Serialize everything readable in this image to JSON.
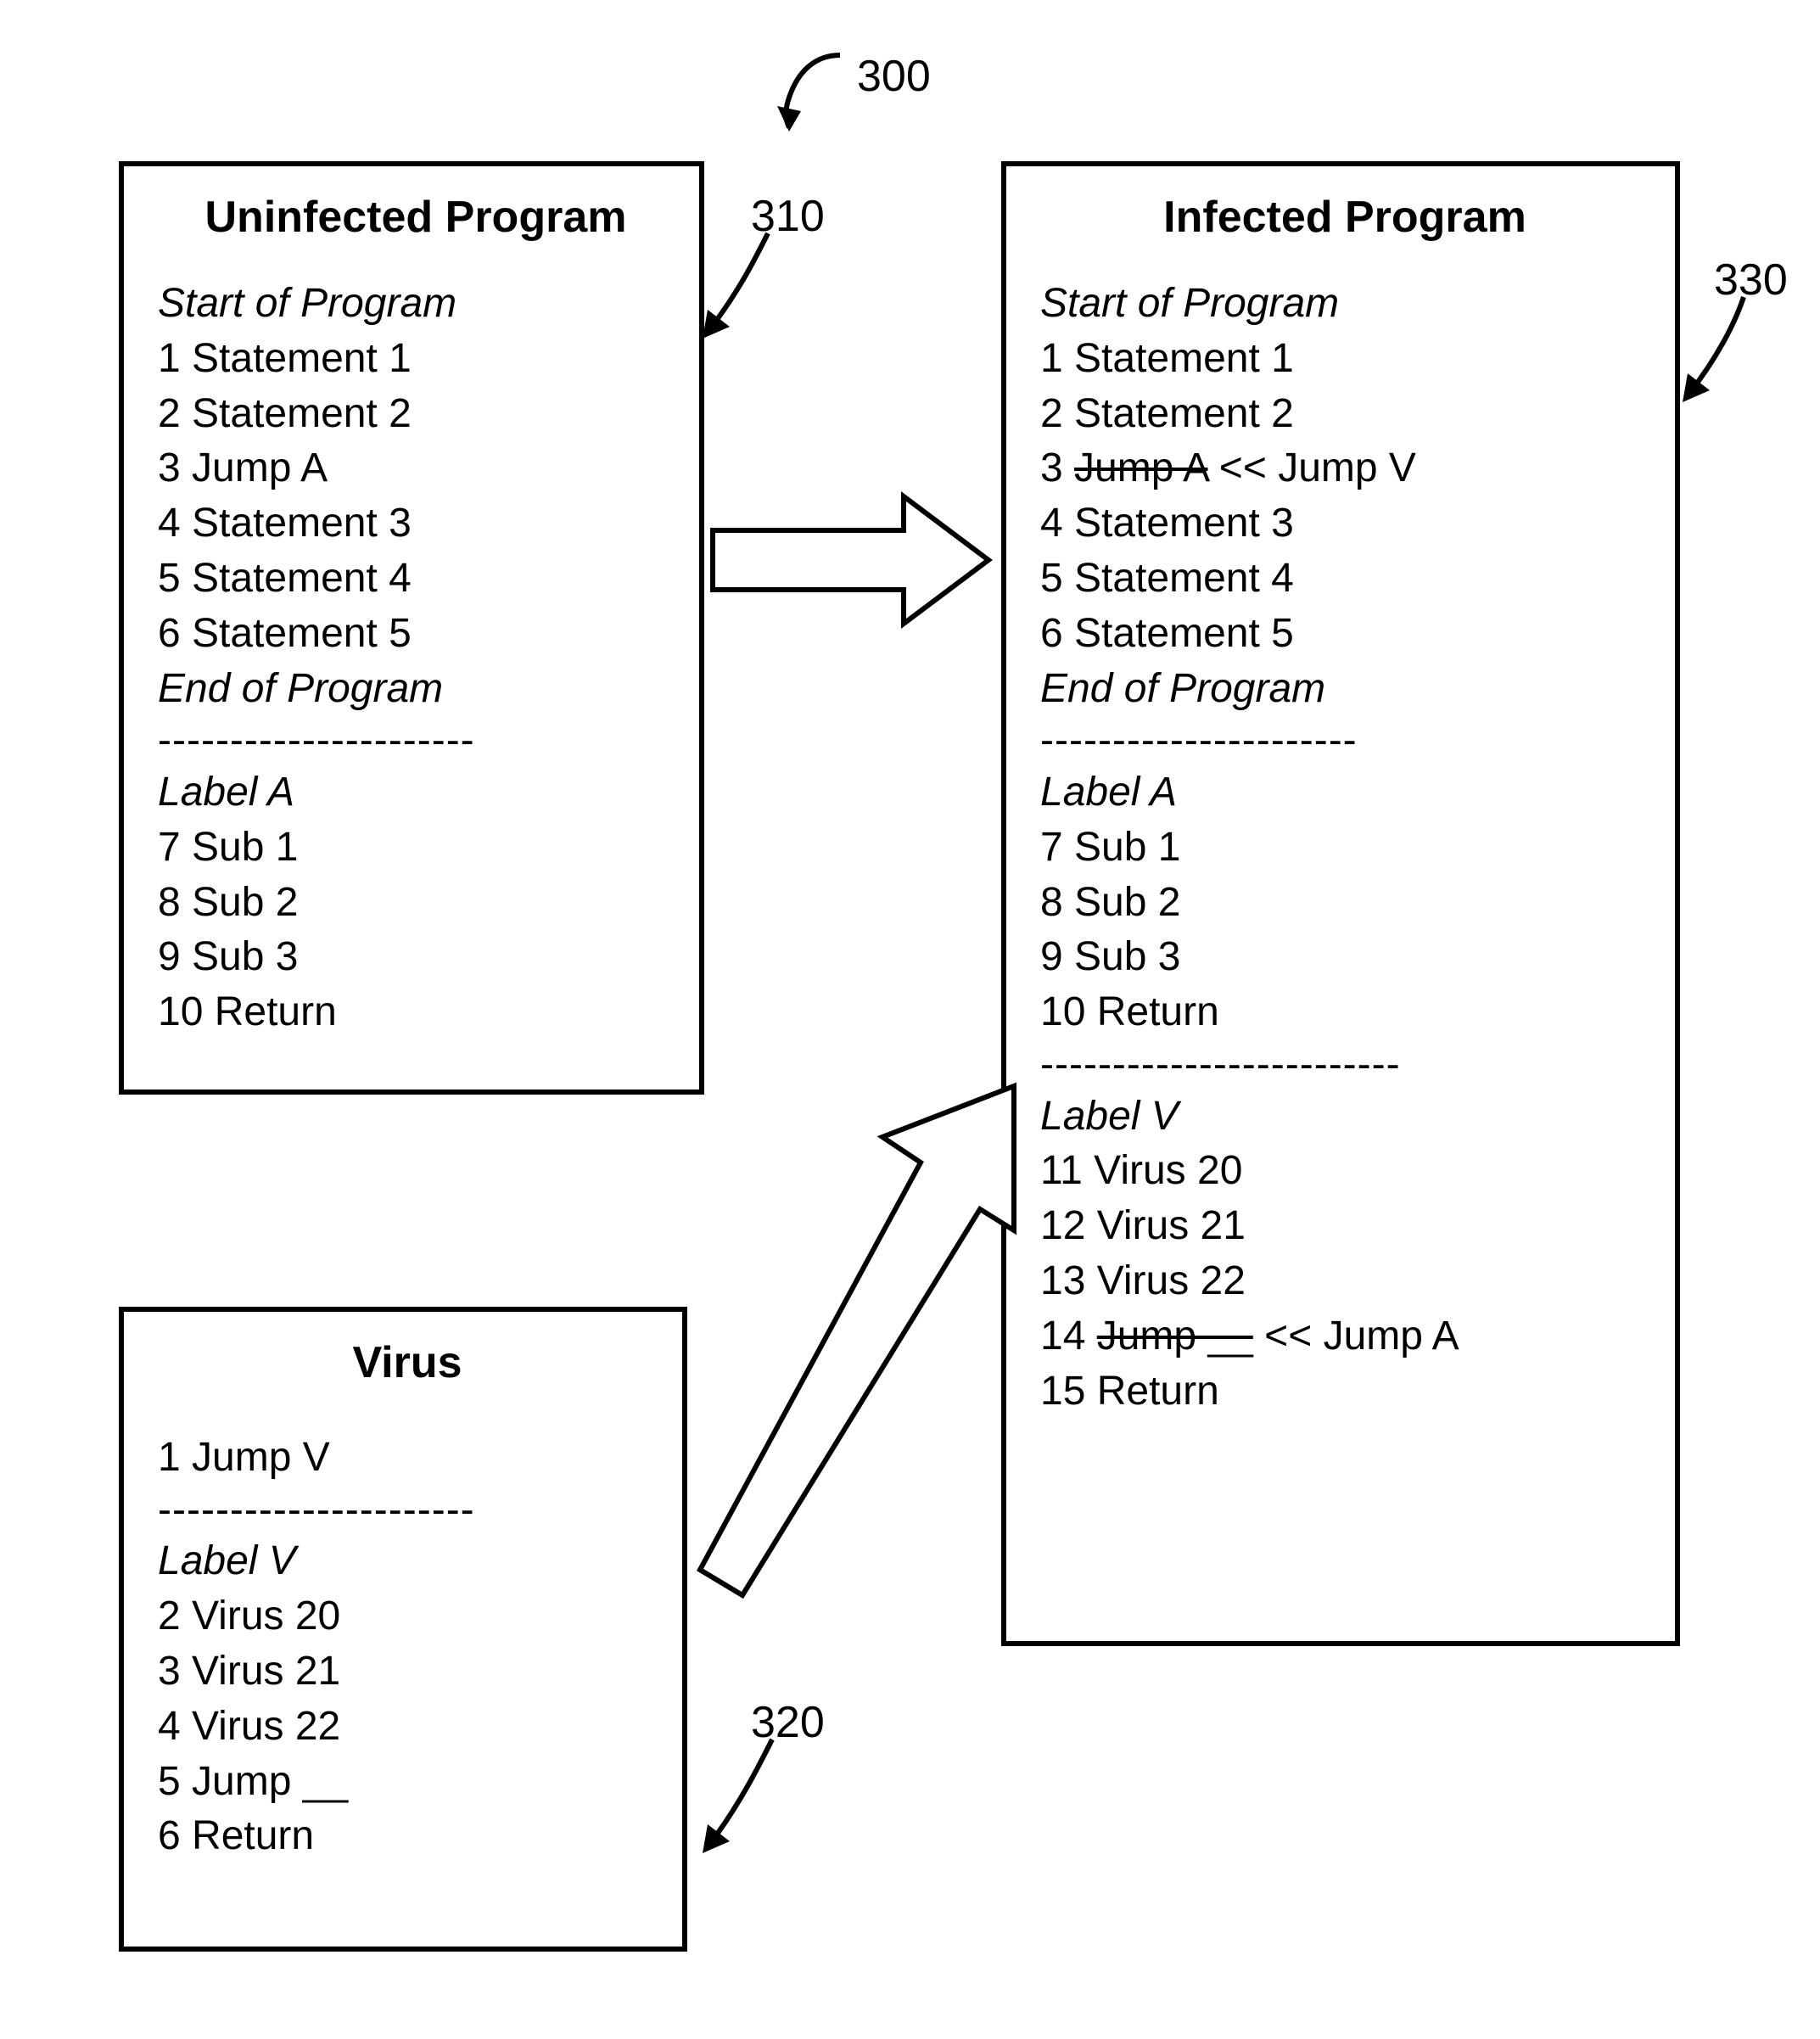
{
  "figure_number": "300",
  "uninfected": {
    "ref": "310",
    "title": "Uninfected Program",
    "start": "Start of Program",
    "l1": "1 Statement 1",
    "l2": "2 Statement 2",
    "l3": "3 Jump A",
    "l4": "4 Statement 3",
    "l5": "5 Statement 4",
    "l6": "6 Statement 5",
    "end": "End of Program",
    "sep": "----------------------",
    "labelA": "Label A",
    "l7": "7 Sub 1",
    "l8": "8 Sub 2",
    "l9": "9 Sub 3",
    "l10": "10 Return"
  },
  "virus": {
    "ref": "320",
    "title": "Virus",
    "l1": "1 Jump V",
    "sep": "----------------------",
    "labelV": "Label V",
    "l2": "2 Virus 20",
    "l3": "3 Virus 21",
    "l4": "4 Virus 22",
    "l5": "5 Jump __",
    "l6": "6 Return"
  },
  "infected": {
    "ref": "330",
    "title": "Infected Program",
    "start": "Start of Program",
    "l1": "1 Statement 1",
    "l2": "2 Statement 2",
    "l3_num": "3 ",
    "l3_strike": "Jump A",
    "l3_repl": "   <<  Jump V",
    "l4": "4 Statement 3",
    "l5": "5 Statement 4",
    "l6": "6 Statement 5",
    "end": "End of Program",
    "sep": "----------------------",
    "labelA": "Label A",
    "l7": "7 Sub 1",
    "l8": "8 Sub 2",
    "l9": "9 Sub 3",
    "l10": "10 Return",
    "sep2": "-------------------------",
    "labelV": "Label V",
    "l11": "11 Virus 20",
    "l12": "12 Virus 21",
    "l13": "13 Virus 22",
    "l14_num": "14 ",
    "l14_strike": "Jump __",
    "l14_repl": "  << Jump A",
    "l15": "15 Return"
  }
}
